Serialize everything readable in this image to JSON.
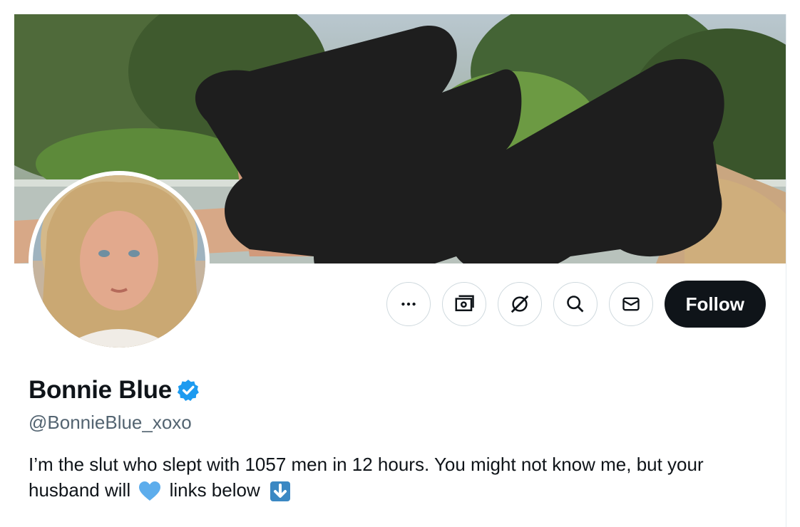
{
  "profile": {
    "display_name": "Bonnie Blue",
    "handle": "@BonnieBlue_xoxo",
    "bio_text_1": "I’m the slut who slept with 1057 men in 12 hours. You might not know me, but your husband will",
    "bio_text_2": "links below",
    "verified": true
  },
  "actions": {
    "more_icon": "more-icon",
    "subscribe_icon": "money-icon",
    "grok_icon": "grok-icon",
    "search_icon": "search-icon",
    "message_icon": "envelope-icon",
    "follow_label": "Follow"
  },
  "colors": {
    "verified_blue": "#1d9bf0",
    "text_primary": "#0f1419",
    "text_secondary": "#536471",
    "follow_bg": "#0f1419"
  }
}
